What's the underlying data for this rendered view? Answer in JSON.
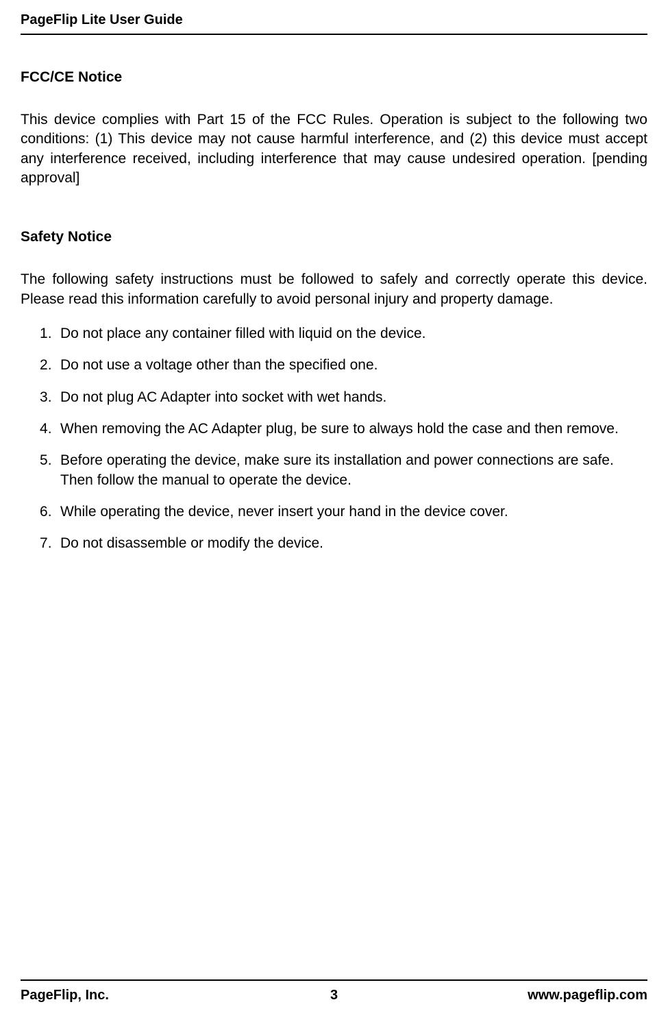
{
  "header": {
    "title": "PageFlip Lite User Guide"
  },
  "sections": {
    "fcc": {
      "heading": "FCC/CE Notice",
      "body": "This device complies with Part 15 of the FCC Rules.  Operation is subject to the following two conditions: (1) This device may not cause harmful interference, and (2) this device must accept any interference received, including interference that may cause undesired operation. [pending approval]"
    },
    "safety": {
      "heading": "Safety Notice",
      "intro": "The following safety instructions must be followed to safely and correctly operate this device. Please read this information carefully to avoid personal injury and property damage.",
      "items": [
        "Do not place any container filled with liquid on the device.",
        "Do not use a voltage other than the specified one.",
        "Do not plug AC Adapter into socket with wet hands.",
        "When removing the AC Adapter plug, be sure to always hold the case and then remove.",
        "Before operating the device, make sure its installation and power connections are safe. Then follow the manual to operate the device.",
        "While operating the device, never insert your hand in the device cover.",
        "Do not disassemble or modify the device."
      ]
    }
  },
  "footer": {
    "left": "PageFlip, Inc.",
    "center": "3",
    "right": "www.pageflip.com"
  }
}
